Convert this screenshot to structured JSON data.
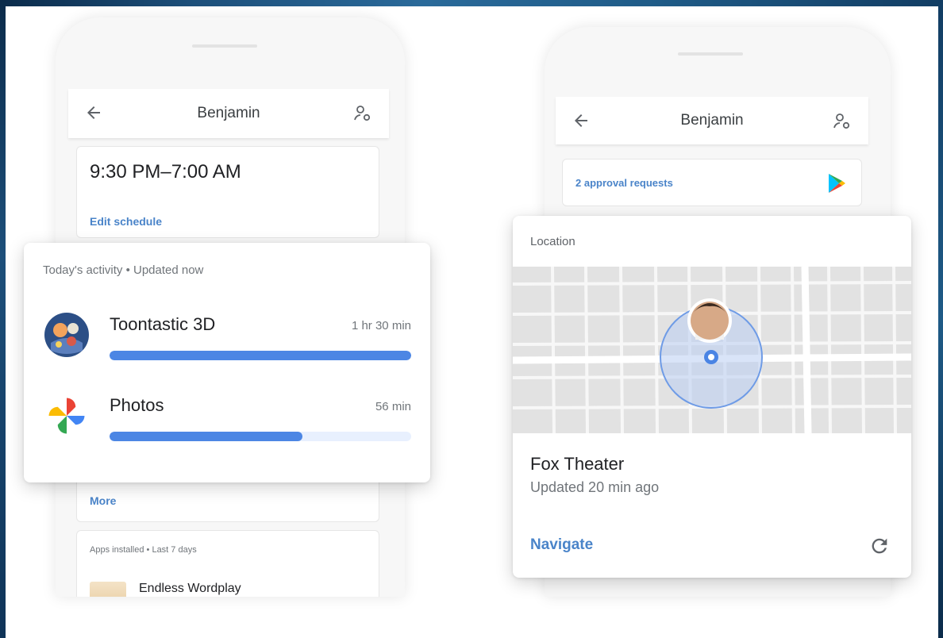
{
  "left_phone": {
    "header": {
      "title": "Benjamin",
      "back_icon": "arrow-back-icon",
      "settings_icon": "person-settings-icon"
    },
    "schedule": {
      "time_range": "9:30 PM–7:00 AM",
      "edit_link": "Edit schedule"
    },
    "activity": {
      "header": "Today's activity • Updated now",
      "apps": [
        {
          "name": "Toontastic 3D",
          "duration": "1 hr 30 min",
          "usage_fraction": 1.0,
          "icon": "toontastic-app-icon"
        },
        {
          "name": "Photos",
          "duration": "56 min",
          "usage_fraction": 0.64,
          "icon": "google-photos-icon"
        }
      ],
      "bar_color": "#4c86e4"
    },
    "more_link": "More",
    "apps_installed": {
      "caption": "Apps installed • Last 7 days",
      "first_app": "Endless Wordplay"
    }
  },
  "right_phone": {
    "header": {
      "title": "Benjamin",
      "back_icon": "arrow-back-icon",
      "settings_icon": "person-settings-icon"
    },
    "approval": {
      "text": "2 approval requests",
      "icon": "google-play-icon"
    },
    "location": {
      "header": "Location",
      "place": "Fox Theater",
      "updated": "Updated 20 min ago",
      "navigate_label": "Navigate",
      "refresh_icon": "refresh-icon"
    }
  },
  "colors": {
    "accent": "#4a84c9",
    "frame": "#1d4f7a"
  }
}
